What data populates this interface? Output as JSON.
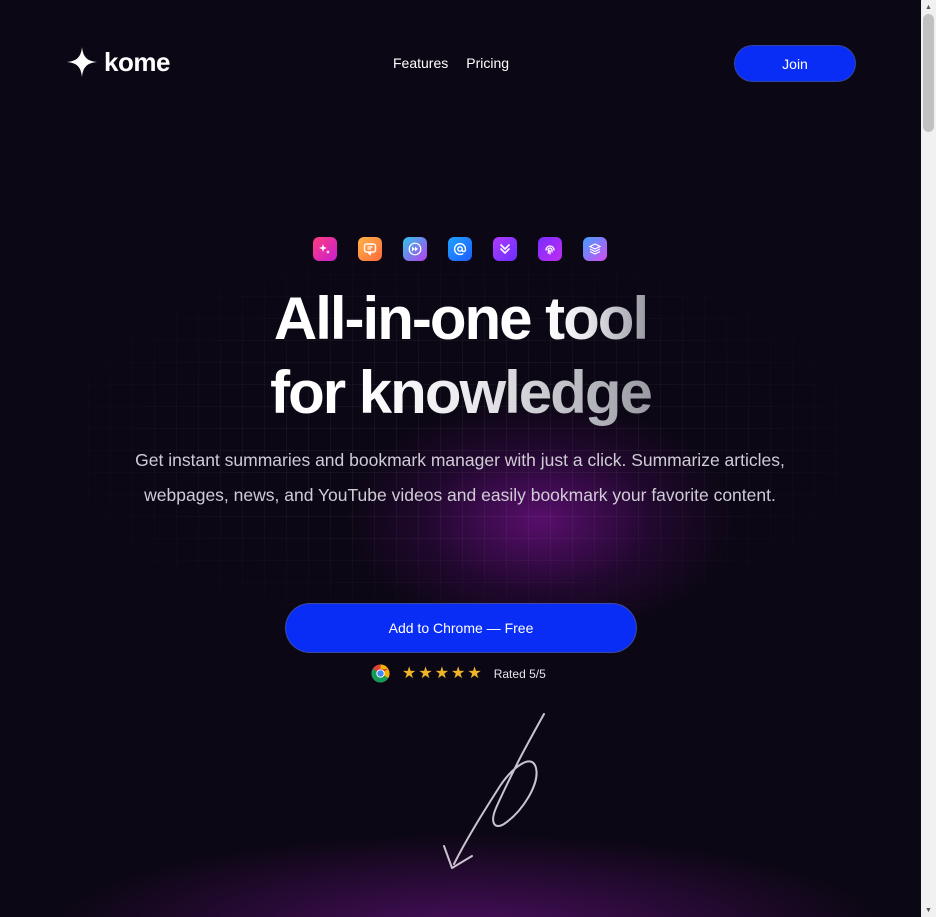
{
  "nav": {
    "logo_text": "kome",
    "links": [
      "Features",
      "Pricing"
    ],
    "join_label": "Join"
  },
  "hero": {
    "icons": [
      {
        "name": "sparkle-icon",
        "colors": [
          "#ff3d7f",
          "#c81fd0"
        ]
      },
      {
        "name": "chat-icon",
        "colors": [
          "#ffb347",
          "#ff6a3d"
        ]
      },
      {
        "name": "fast-forward-icon",
        "colors": [
          "#2fc6e8",
          "#b73cf0"
        ]
      },
      {
        "name": "at-sign-icon",
        "colors": [
          "#1fa3ff",
          "#1f5bff"
        ]
      },
      {
        "name": "chevrons-down-icon",
        "colors": [
          "#b03cff",
          "#6a2dff"
        ]
      },
      {
        "name": "fingerprint-icon",
        "colors": [
          "#7a2dff",
          "#c02df0"
        ]
      },
      {
        "name": "layers-icon",
        "colors": [
          "#3fa0ff",
          "#d64bf2"
        ]
      }
    ],
    "title_line1_a": "All-in-one",
    "title_line1_b": "tool",
    "title_line2_a": "for",
    "title_line2_b": "knowledge",
    "subtitle_line1": "Get instant summaries and bookmark manager with just a click. Summarize articles,",
    "subtitle_line2": "webpages, news, and YouTube videos and easily bookmark your favorite content.",
    "cta_label": "Add to Chrome — Free",
    "rating_text": "Rated 5/5",
    "rating_stars": 5
  },
  "colors": {
    "accent": "#0a2df5",
    "background": "#0c0714",
    "star": "#f0b429"
  }
}
